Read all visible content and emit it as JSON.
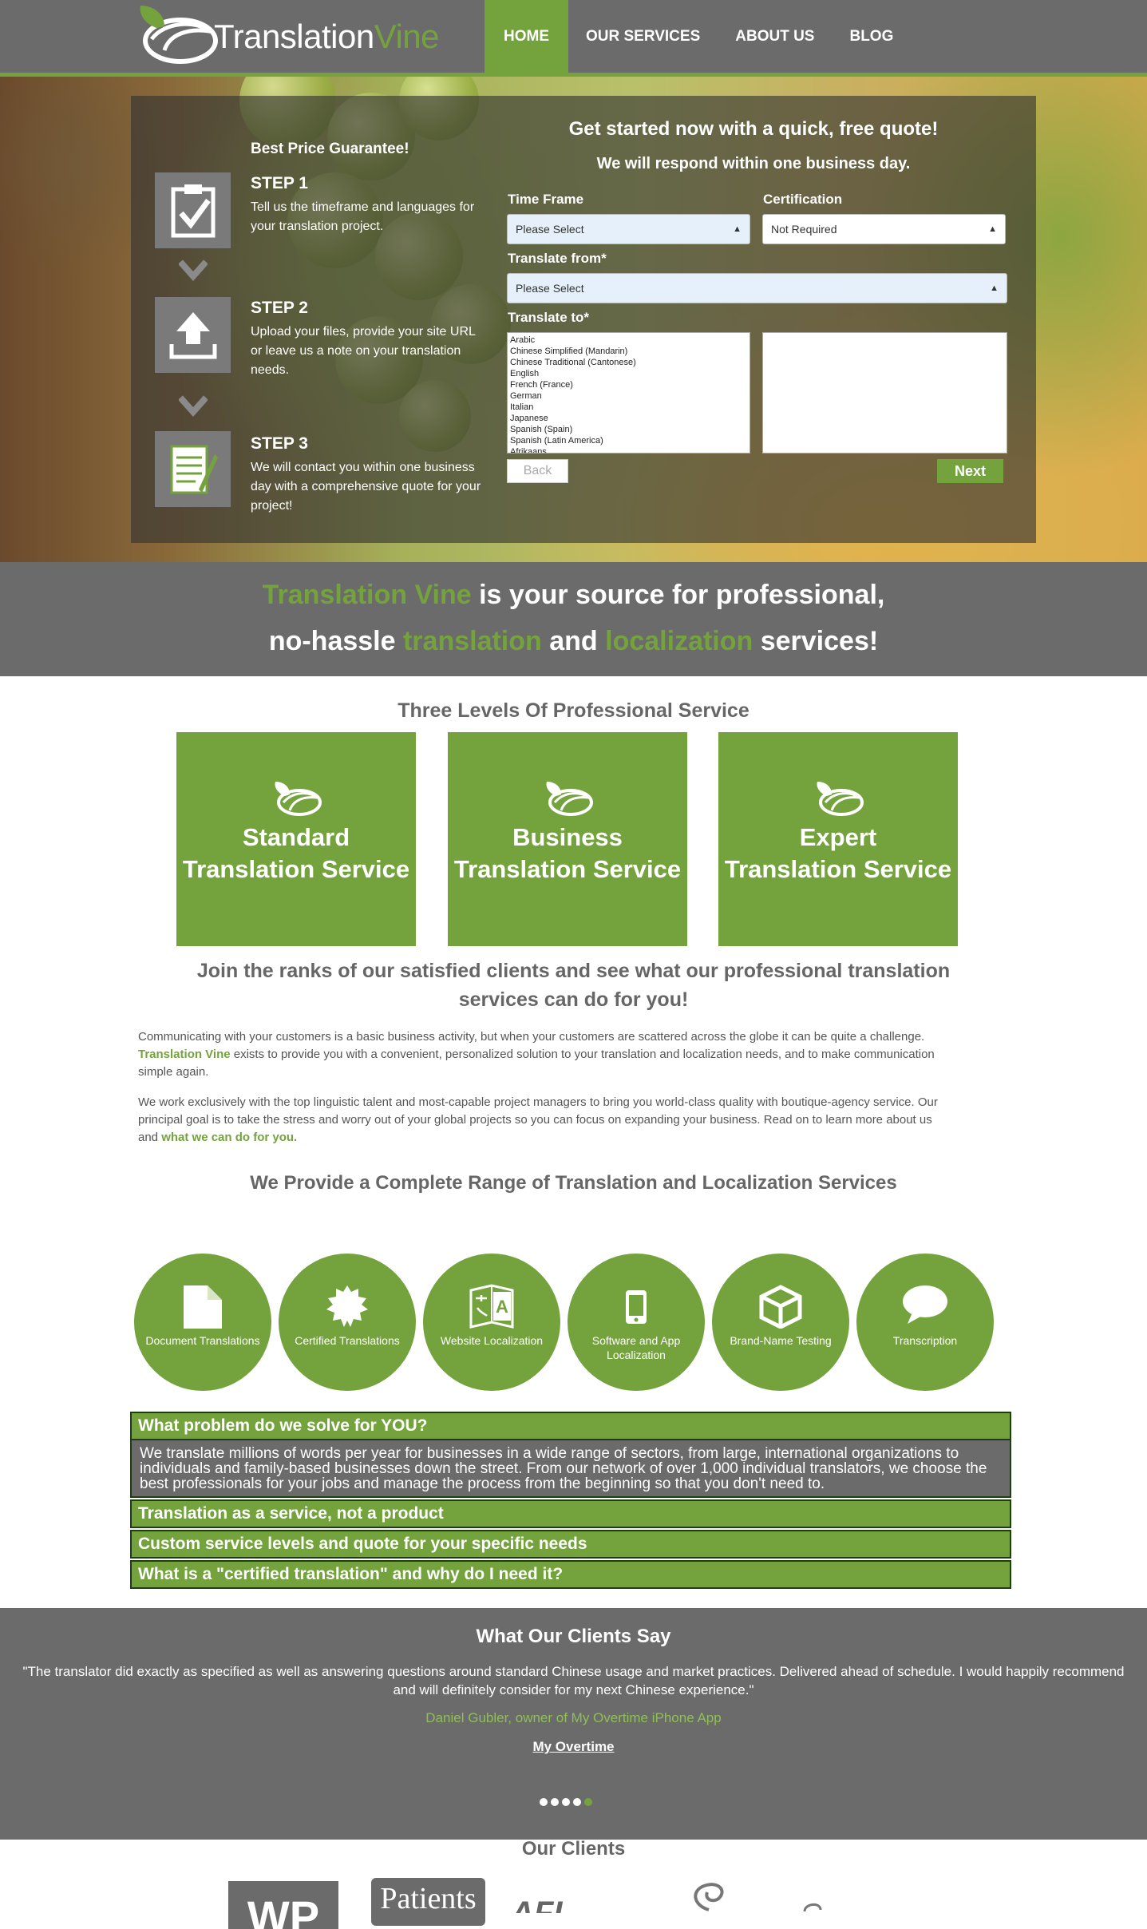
{
  "brand": {
    "part1": "Translation",
    "part2": "Vine"
  },
  "nav": [
    {
      "label": "HOME",
      "active": true
    },
    {
      "label": "OUR SERVICES"
    },
    {
      "label": "ABOUT US"
    },
    {
      "label": "BLOG"
    }
  ],
  "hero": {
    "best_price": "Best Price Guarantee!",
    "steps": [
      {
        "title": "STEP 1",
        "desc": "Tell us the timeframe and languages for your translation project.",
        "icon": "clipboard-check-icon"
      },
      {
        "title": "STEP 2",
        "desc": "Upload your files, provide your site URL or leave us a note on your translation needs.",
        "icon": "upload-icon"
      },
      {
        "title": "STEP 3",
        "desc": "We will contact you within one business day with a comprehensive quote for your project!",
        "icon": "notepad-pencil-icon"
      }
    ],
    "quote_title": "Get started now with a quick, free quote!",
    "quote_sub": "We will respond within one business day.",
    "timeframe": {
      "label": "Time Frame",
      "value": "Please Select"
    },
    "certification": {
      "label": "Certification",
      "value": "Not Required"
    },
    "translate_from": {
      "label": "Translate from*",
      "value": "Please Select"
    },
    "translate_to": {
      "label": "Translate to*",
      "options": [
        "Arabic",
        "Chinese Simplified (Mandarin)",
        "Chinese Traditional (Cantonese)",
        "English",
        "French (France)",
        "German",
        "Italian",
        "Japanese",
        "Spanish (Spain)",
        "Spanish (Latin America)",
        "Afrikaans"
      ]
    },
    "back": "Back",
    "next": "Next"
  },
  "tagline": {
    "a": "Translation Vine",
    "b": " is your source for professional,",
    "c": "no-hassle ",
    "d": "translation",
    "e": " and ",
    "f": "localization",
    "g": " services!"
  },
  "levels": {
    "title": "Three Levels Of Professional Service",
    "tiles": [
      {
        "l1": "Standard",
        "l2": "Translation Service"
      },
      {
        "l1": "Business",
        "l2": "Translation Service"
      },
      {
        "l1": "Expert",
        "l2": "Translation Service"
      }
    ]
  },
  "join": "Join the ranks of our satisfied clients and see what our professional translation services can do for you!",
  "p1": {
    "a": "Communicating with your customers is a basic business activity, but when your customers are scattered across the globe it can be quite a challenge. ",
    "b": "Translation Vine",
    "c": " exists to provide you with a convenient, personalized solution to your translation and localization needs, and to make communication simple again."
  },
  "p2": {
    "a": "We work exclusively with the top linguistic talent and most-capable project managers to bring you world-class quality with boutique-agency service. Our principal goal is to take the stress and worry out of your global projects so you can focus on expanding your business. Read on to learn more about us and ",
    "b": "what we can do for you."
  },
  "services": {
    "title": "We Provide a Complete Range of Translation and Localization Services",
    "items": [
      {
        "label": "Document Translations",
        "icon": "document-icon"
      },
      {
        "label": "Certified Translations",
        "icon": "seal-icon"
      },
      {
        "label": "Website Localization",
        "icon": "translate-icon"
      },
      {
        "label": "Software and App Localization",
        "icon": "phone-icon"
      },
      {
        "label": "Brand-Name Testing",
        "icon": "box-icon"
      },
      {
        "label": "Transcription",
        "icon": "speech-bubble-icon"
      }
    ]
  },
  "faq": [
    {
      "q": "What problem do we solve for YOU?",
      "a": "We translate millions of words per year for businesses in a wide range of sectors, from large, international organizations to individuals and family-based businesses down the street. From our network of over 1,000 individual translators, we choose the best professionals for your jobs and manage the process from the beginning so that you don't need to."
    },
    {
      "q": "Translation as a service, not a product"
    },
    {
      "q": "Custom service levels and quote for your specific needs"
    },
    {
      "q": "What is a \"certified translation\" and why do I need it?"
    }
  ],
  "testimonials": {
    "title": "What Our Clients Say",
    "quote": "\"The translator did exactly as specified as well as answering questions around standard Chinese usage and market practices. Delivered ahead of schedule. I would happily recommend and will definitely consider for my next Chinese experience.\"",
    "author": "Daniel Gubler, owner of My Overtime iPhone App",
    "link": "My Overtime",
    "dots": 5,
    "active_dot": 4
  },
  "clients": {
    "title": "Our Clients",
    "logo_text": [
      "WP",
      "Patients",
      "AFI"
    ]
  },
  "colors": {
    "green": "#74a33d",
    "gray": "#6b6b6b"
  }
}
